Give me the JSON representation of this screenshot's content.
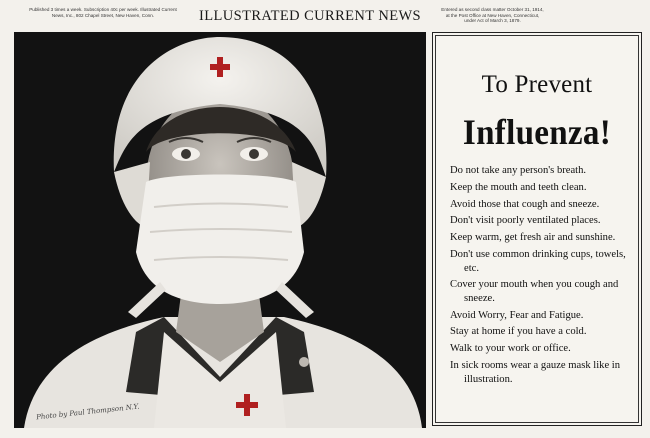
{
  "header": {
    "left_notice": "Published 3 times a week. Subscription 40c per week. Illustrated Current News, Inc., 802 Chapel Street, New Haven, Conn.",
    "masthead": "ILLUSTRATED CURRENT NEWS",
    "right_notice": "Entered as second class matter October 31, 1914, at the Post Office at New Haven, Connecticut, under Act of March 3, 1879."
  },
  "photo": {
    "credit": "Photo by Paul Thompson N.Y."
  },
  "panel": {
    "title_line1": "To Prevent",
    "title_line2": "Influenza!",
    "rules": [
      "Do not take any person's breath.",
      "Keep the mouth and teeth clean.",
      "Avoid those that cough and sneeze.",
      "Don't visit poorly ventilated places.",
      "Keep warm, get fresh air and sunshine.",
      "Don't use common drinking cups, towels, etc.",
      "Cover your mouth when you cough and sneeze.",
      "Avoid Worry, Fear and Fatigue.",
      "Stay at home if you have a cold.",
      "Walk to your work or office.",
      "In sick rooms wear a gauze mask like in illustration."
    ]
  },
  "colors": {
    "paper": "#f3f1ec",
    "ink": "#111111",
    "photo_background": "#121212",
    "cross_red": "#b02020"
  }
}
